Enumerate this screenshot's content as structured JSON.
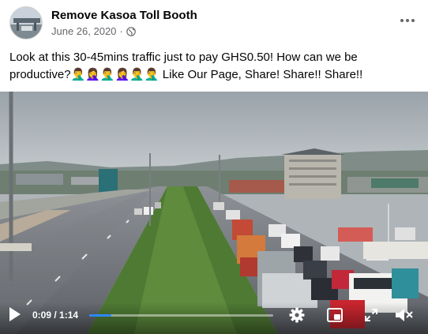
{
  "post": {
    "page_name": "Remove Kasoa Toll Booth",
    "date": "June 26, 2020",
    "separator": "·",
    "text": "Look at this 30-45mins traffic just to pay GHS0.50! How can we be productive?🤦‍♂️🤦‍♀️🤦‍♂️🤦‍♀️🤦‍♂️🤦‍♂️  Like Our Page, Share! Share!! Share!!"
  },
  "video": {
    "current_time": "0:09",
    "duration": "1:14",
    "time_separator": " / ",
    "progress_fraction": 0.12
  },
  "icons": {
    "privacy": "globe-icon",
    "more": "more-options-icon",
    "play": "play-icon",
    "settings": "gear-icon",
    "pip": "picture-in-picture-icon",
    "fullscreen": "expand-icon",
    "volume": "volume-icon"
  },
  "colors": {
    "progress_accent": "#2d88ff",
    "meta_text": "#65676b"
  }
}
